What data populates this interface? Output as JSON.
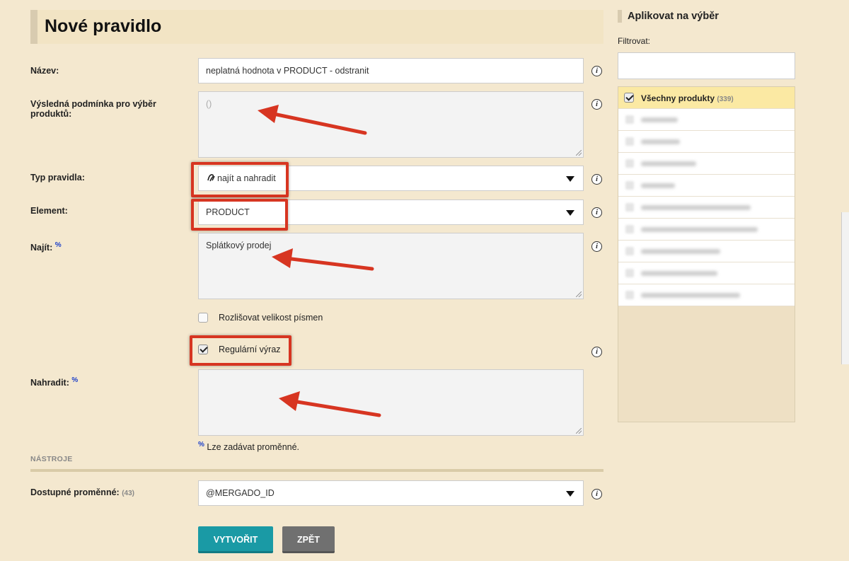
{
  "page": {
    "title": "Nové pravidlo"
  },
  "form": {
    "name": {
      "label": "Název:",
      "value": "neplatná hodnota v PRODUCT - odstranit"
    },
    "condition": {
      "label": "Výsledná podmínka pro výběr produktů:",
      "placeholder": "()"
    },
    "rule_type": {
      "label": "Typ pravidla:",
      "icon": "find-replace-icon",
      "value": "najít a nahradit"
    },
    "element": {
      "label": "Element:",
      "value": "PRODUCT"
    },
    "find": {
      "label": "Najít:",
      "pct": "%",
      "value": "Splátkový prodej"
    },
    "case_sensitive": {
      "label": "Rozlišovat velikost písmen",
      "checked": false
    },
    "regex": {
      "label": "Regulární výraz",
      "checked": true
    },
    "replace": {
      "label": "Nahradit:",
      "pct": "%",
      "value": ""
    },
    "hint": {
      "pct": "%",
      "text": "Lze zadávat proměnné."
    },
    "tools_section": "NÁSTROJE",
    "variables": {
      "label": "Dostupné proměnné:",
      "count": "(43)",
      "value": "@MERGADO_ID"
    }
  },
  "buttons": {
    "create": "VYTVOŘIT",
    "back": "ZPĚT"
  },
  "right_panel": {
    "title": "Aplikovat na výběr",
    "filter_label": "Filtrovat:",
    "all_products": {
      "label": "Všechny produkty",
      "count": "(339)",
      "checked": true
    }
  },
  "info_icon_glyph": "i",
  "colors": {
    "background": "#f4e8cf",
    "primary_button": "#1a9aa5",
    "secondary_button": "#707070",
    "annotation_red": "#d73521",
    "selected_row": "#fbe9a3"
  }
}
